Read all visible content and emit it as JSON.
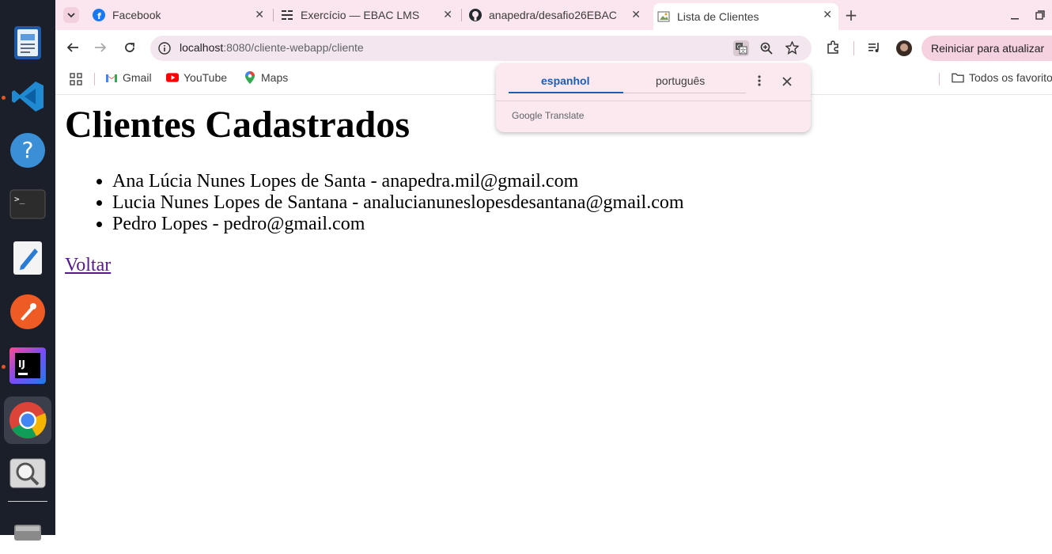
{
  "dock": {
    "items": [
      {
        "name": "document-viewer-icon"
      },
      {
        "name": "vscode-icon"
      },
      {
        "name": "help-icon"
      },
      {
        "name": "terminal-icon"
      },
      {
        "name": "text-editor-icon"
      },
      {
        "name": "postman-icon"
      },
      {
        "name": "intellij-icon",
        "label": "IJ"
      },
      {
        "name": "chrome-icon"
      },
      {
        "name": "image-viewer-icon"
      },
      {
        "name": "drive-icon"
      }
    ]
  },
  "browser": {
    "tabs": [
      {
        "title": "Facebook",
        "icon": "facebook-icon"
      },
      {
        "title": "Exercício — EBAC LMS",
        "icon": "ebac-icon"
      },
      {
        "title": "anapedra/desafio26EBAC",
        "icon": "github-icon"
      },
      {
        "title": "Lista de Clientes",
        "icon": "page-icon",
        "active": true
      }
    ],
    "new_tab": "+",
    "address": {
      "host": "localhost",
      "path": ":8080/cliente-webapp/cliente"
    },
    "restart_label": "Reiniciar para atualizar",
    "bookmarks": [
      {
        "label": "Gmail",
        "icon": "gmail-icon"
      },
      {
        "label": "YouTube",
        "icon": "youtube-icon"
      },
      {
        "label": "Maps",
        "icon": "maps-icon"
      }
    ],
    "all_bookmarks": "Todos os favoritos"
  },
  "page": {
    "title": "Clientes Cadastrados",
    "clients": [
      "Ana Lúcia Nunes Lopes de Santa - anapedra.mil@gmail.com",
      "Lucia Nunes Lopes de Santana - analucianuneslopesdesantana@gmail.com",
      "Pedro Lopes - pedro@gmail.com"
    ],
    "back_link": "Voltar"
  },
  "translate": {
    "source_lang": "espanhol",
    "target_lang": "português",
    "brand": "Google Translate"
  }
}
